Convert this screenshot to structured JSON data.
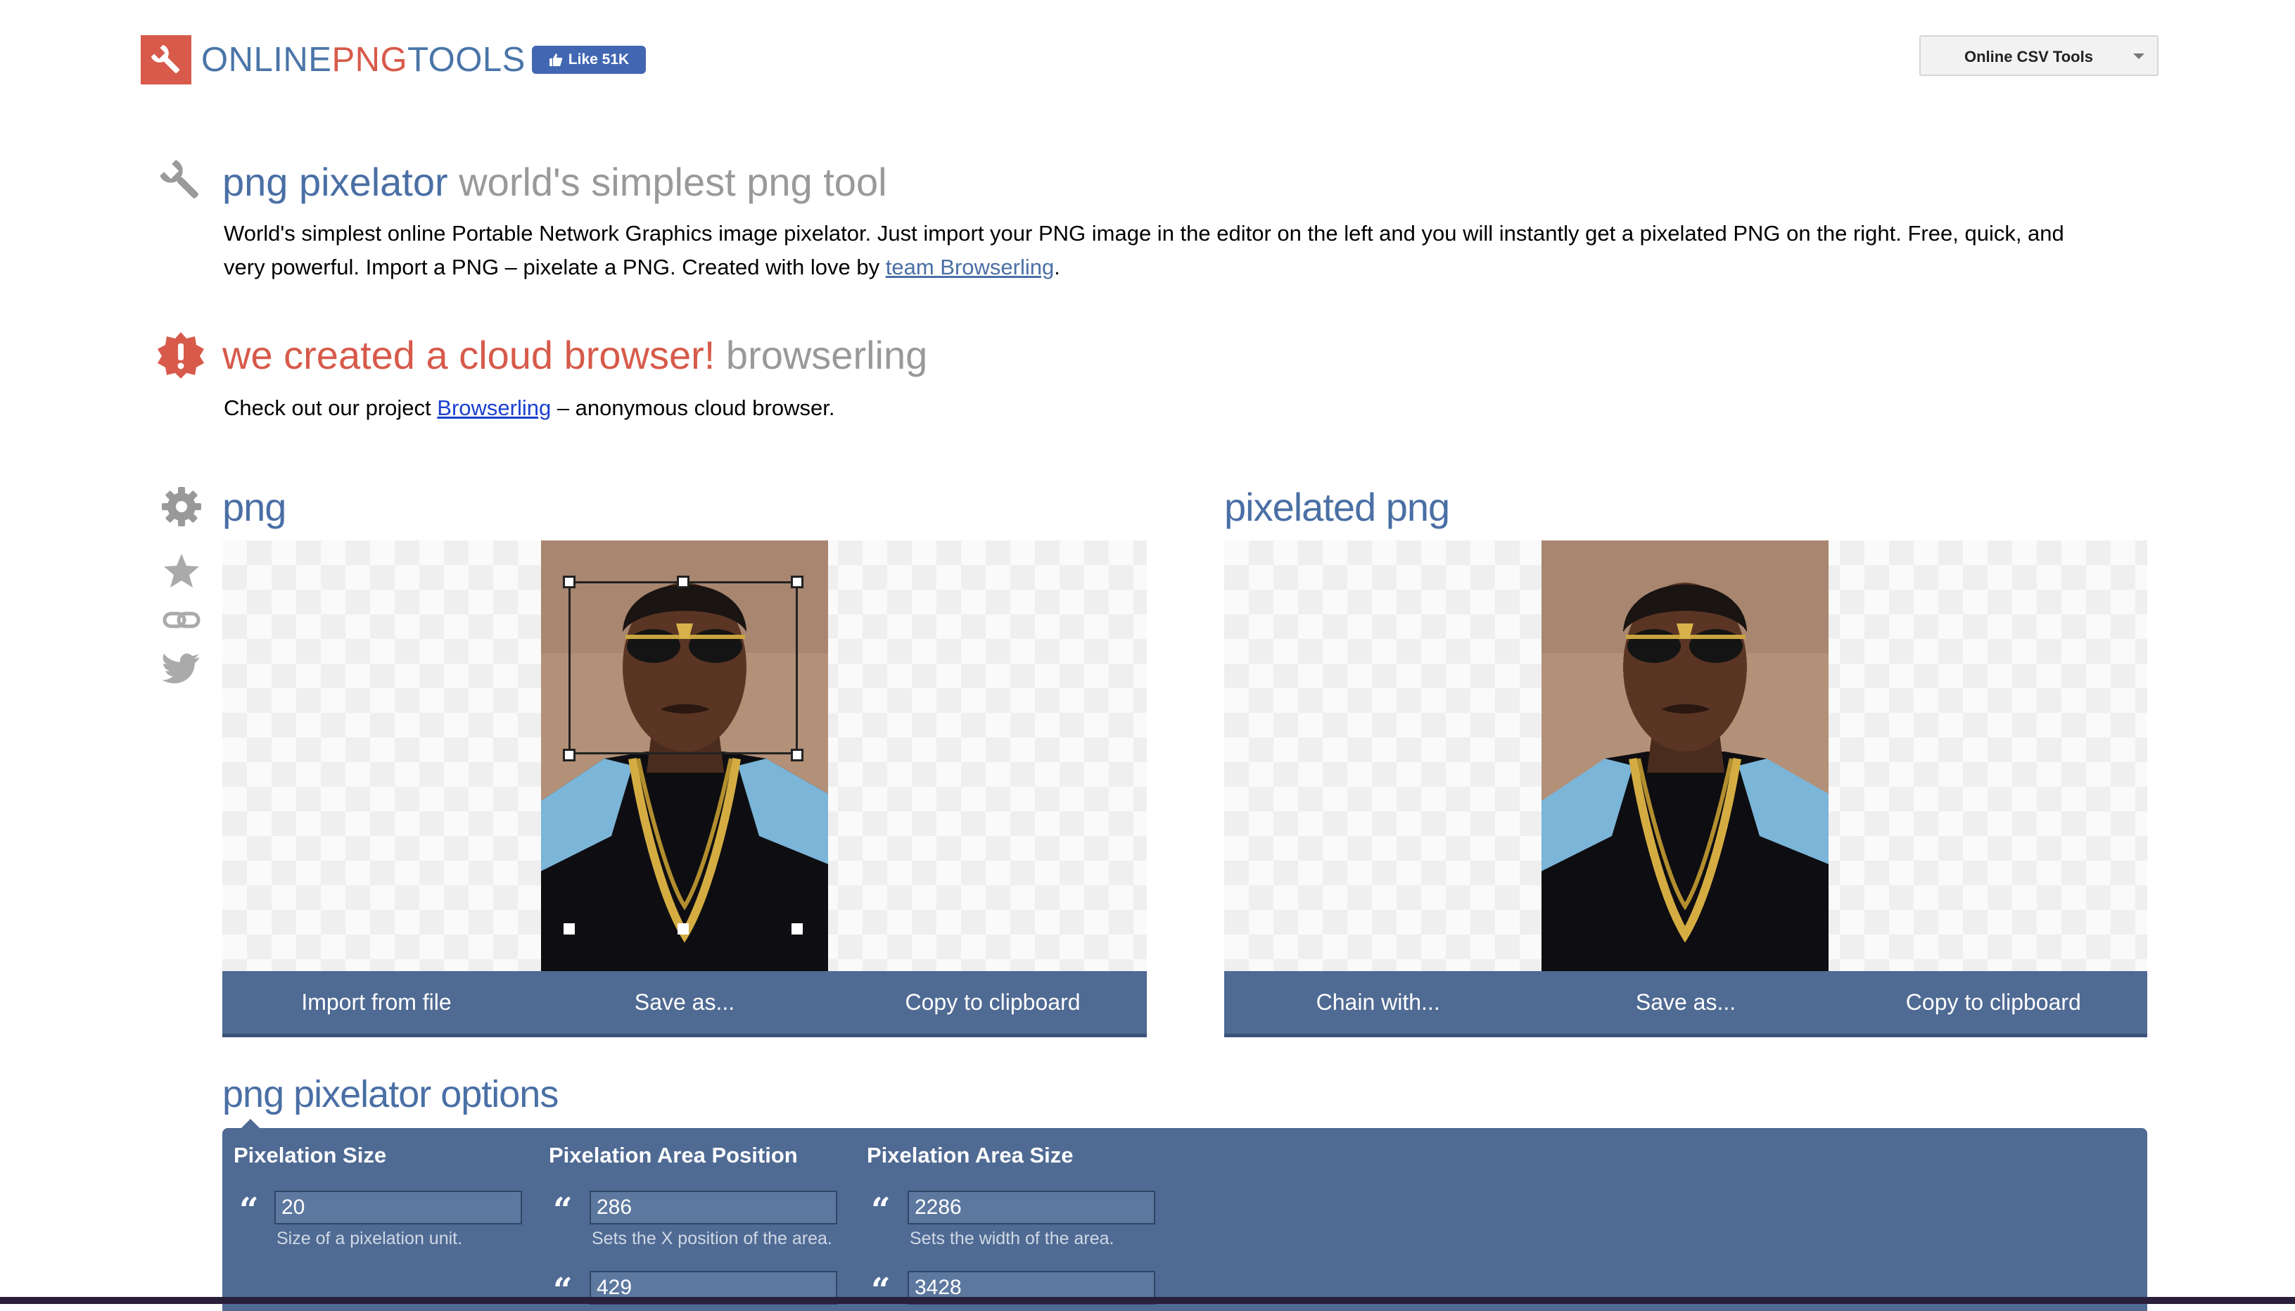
{
  "header": {
    "logo_parts": [
      "ONLINE",
      "PNG",
      "TOOLS"
    ],
    "fb_like": "Like 51K",
    "tools_dropdown": "Online CSV Tools"
  },
  "tool": {
    "title": "png pixelator",
    "subtitle": "world's simplest png tool",
    "desc_1": "World's simplest online Portable Network Graphics image pixelator. Just import your PNG image in the editor on the left and you will instantly get a pixelated PNG on the right. Free, quick, and",
    "desc_2_before": "very powerful. Import a PNG – pixelate a PNG. Created with love by ",
    "desc_2_link": "team Browserling",
    "desc_2_after": "."
  },
  "promo": {
    "title": "we created a cloud browser!",
    "subtitle": "browserling",
    "text_before": "Check out our project ",
    "link": "Browserling",
    "text_after": " – anonymous cloud browser."
  },
  "input_panel": {
    "title": "png",
    "buttons": [
      "Import from file",
      "Save as...",
      "Copy to clipboard"
    ]
  },
  "output_panel": {
    "title": "pixelated png",
    "buttons": [
      "Chain with...",
      "Save as...",
      "Copy to clipboard"
    ]
  },
  "options": {
    "title": "png pixelator options",
    "groups": [
      {
        "heading": "Pixelation Size",
        "fields": [
          {
            "value": "20",
            "hint": "Size of a pixelation unit."
          }
        ]
      },
      {
        "heading": "Pixelation Area Position",
        "fields": [
          {
            "value": "286",
            "hint": "Sets the X position of the area."
          },
          {
            "value": "429",
            "hint": ""
          }
        ]
      },
      {
        "heading": "Pixelation Area Size",
        "fields": [
          {
            "value": "2286",
            "hint": "Sets the width of the area."
          },
          {
            "value": "3428",
            "hint": ""
          }
        ]
      }
    ]
  },
  "colors": {
    "brand_red": "#d75a4a",
    "brand_blue": "#4a6fa5",
    "button_bar": "#4f6a93"
  }
}
